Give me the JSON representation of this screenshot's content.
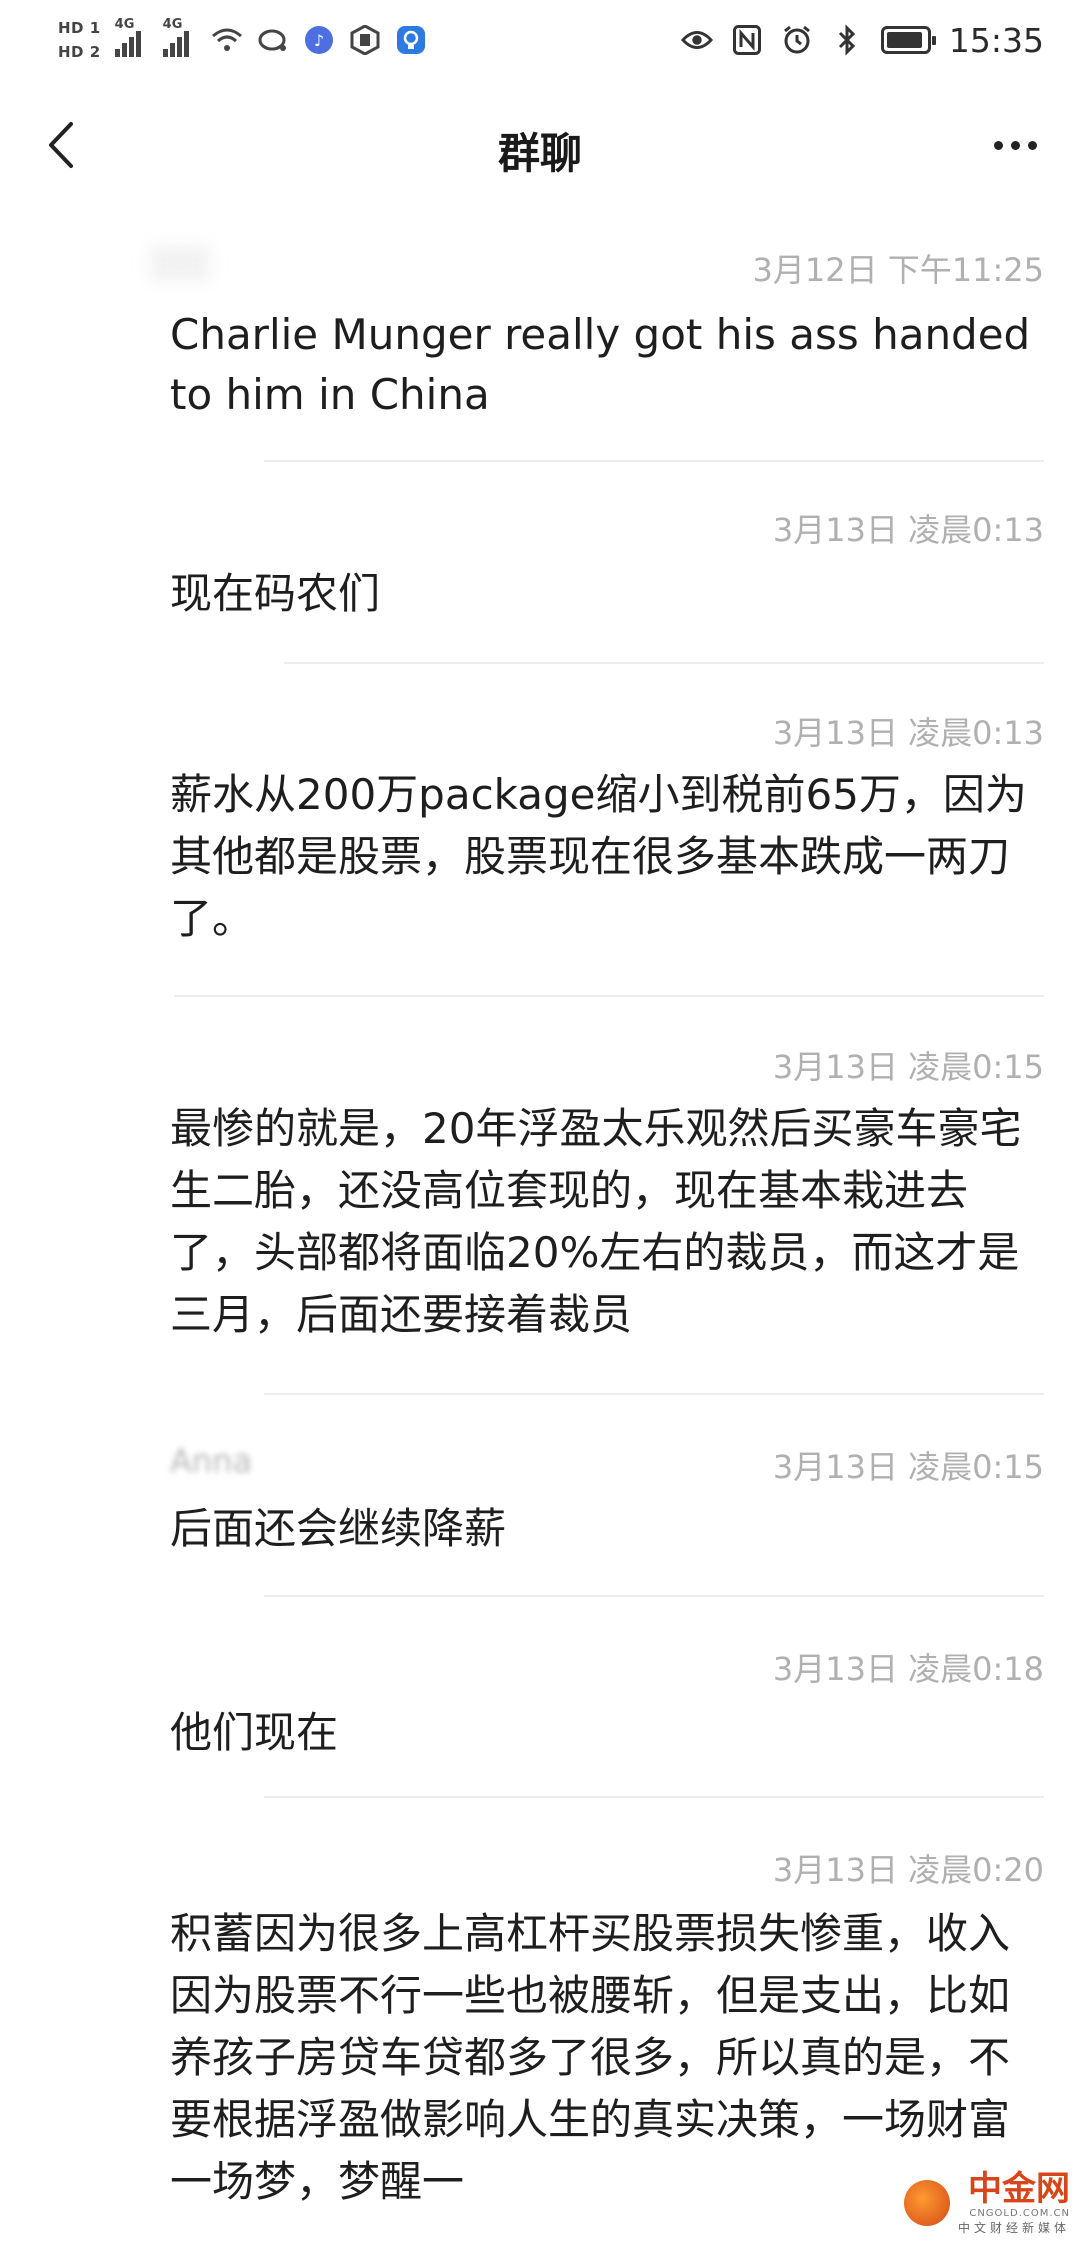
{
  "status_bar": {
    "hd1": "HD 1",
    "hd2": "HD 2",
    "net1": "4G",
    "net2": "4G",
    "time": "15:35",
    "icons": [
      "wifi-icon",
      "cloud-chat-icon",
      "music-app-icon",
      "hand-app-icon",
      "bulb-app-icon",
      "eye-icon",
      "nfc-icon",
      "alarm-icon",
      "bluetooth-icon",
      "battery-icon"
    ]
  },
  "header": {
    "title": "群聊"
  },
  "messages": [
    {
      "time": "3月12日 下午11:25",
      "text": "Charlie Munger really got his ass handed to him in China"
    },
    {
      "time": "3月13日 凌晨0:13",
      "text": "现在码农们"
    },
    {
      "time": "3月13日 凌晨0:13",
      "text": "薪水从200万package缩小到税前65万，因为其他都是股票，股票现在很多基本跌成一两刀了。"
    },
    {
      "time": "3月13日 凌晨0:15",
      "text": "最惨的就是，20年浮盈太乐观然后买豪车豪宅生二胎，还没高位套现的，现在基本栽进去了，头部都将面临20%左右的裁员，而这才是三月，后面还要接着裁员"
    },
    {
      "sender": "Anna",
      "time": "3月13日 凌晨0:15",
      "text": "后面还会继续降薪"
    },
    {
      "time": "3月13日 凌晨0:18",
      "text": "他们现在"
    },
    {
      "time": "3月13日 凌晨0:20",
      "text": "积蓄因为很多上高杠杆买股票损失惨重，收入因为股票不行一些也被腰斩，但是支出，比如养孩子房贷车贷都多了很多，所以真的是，不要根据浮盈做影响人生的真实决策，一场财富一场梦，梦醒一"
    }
  ],
  "watermark": {
    "name": "中金网",
    "domain": "CNGOLD.COM.CN",
    "slogan": "中文财经新媒体"
  }
}
